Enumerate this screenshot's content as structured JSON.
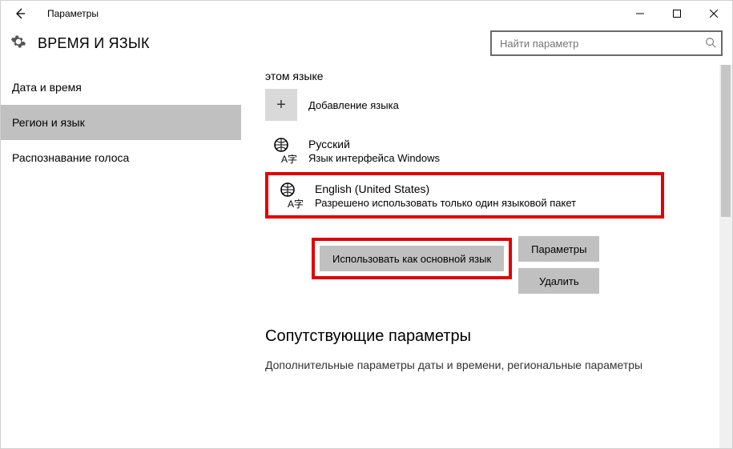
{
  "window": {
    "title": "Параметры"
  },
  "header": {
    "page_title": "ВРЕМЯ И ЯЗЫК",
    "search_placeholder": "Найти параметр"
  },
  "sidebar": {
    "items": [
      {
        "label": "Дата и время",
        "name": "sidebar-item-date-time"
      },
      {
        "label": "Регион и язык",
        "name": "sidebar-item-region-language"
      },
      {
        "label": "Распознавание голоса",
        "name": "sidebar-item-speech"
      }
    ],
    "active_index": 1
  },
  "content": {
    "truncated_top": "этом языке",
    "add_language_label": "Добавление языка",
    "languages": [
      {
        "name": "Русский",
        "sub": "Язык интерфейса Windows"
      },
      {
        "name": "English (United States)",
        "sub": "Разрешено использовать только один языковой пакет"
      }
    ],
    "buttons": {
      "set_default": "Использовать как основной язык",
      "options": "Параметры",
      "remove": "Удалить"
    },
    "related_heading": "Сопутствующие параметры",
    "related_link": "Дополнительные параметры даты и времени, региональные параметры"
  }
}
